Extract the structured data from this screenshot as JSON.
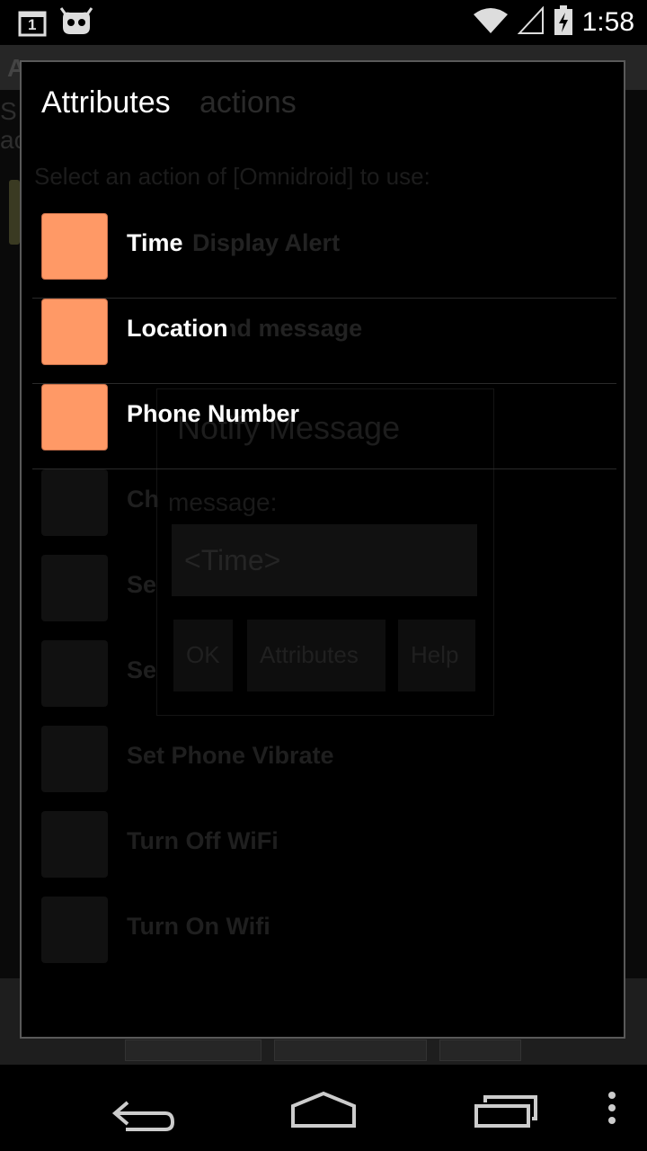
{
  "status_bar": {
    "clock": "1:58",
    "notification_badge": "1",
    "icons": [
      "calendar-notification-icon",
      "android-mod-icon",
      "wifi-icon",
      "signal-icon",
      "battery-charging-icon"
    ]
  },
  "background_activity": {
    "title_partial": "A",
    "side_text_1": "S",
    "side_text_2": "ac",
    "inner_dialog": {
      "title": "Notify Message",
      "message_label": "message:",
      "input_value": "<Time>",
      "buttons": [
        "OK",
        "Attributes",
        "Help"
      ]
    },
    "ghost_dialog_title": "actions",
    "ghost_prompt": "Select an action of [Omnidroid] to use:",
    "ghost_labels": [
      "Display Alert",
      "Send message"
    ]
  },
  "dialog": {
    "title": "Attributes",
    "items": [
      {
        "label": "Time",
        "swatch_color": "#ff9966"
      },
      {
        "label": "Location",
        "swatch_color": "#ff9966"
      },
      {
        "label": "Phone Number",
        "swatch_color": "#ff9966"
      }
    ],
    "dimmed_items": [
      {
        "label": "Ch"
      },
      {
        "label": "Se"
      },
      {
        "label": "Se"
      },
      {
        "label": "Set Phone Vibrate"
      },
      {
        "label": "Turn Off WiFi"
      },
      {
        "label": "Turn On Wifi"
      }
    ]
  },
  "nav_bar": {
    "icons": [
      "back-icon",
      "home-icon",
      "recents-icon",
      "overflow-menu-icon"
    ]
  }
}
